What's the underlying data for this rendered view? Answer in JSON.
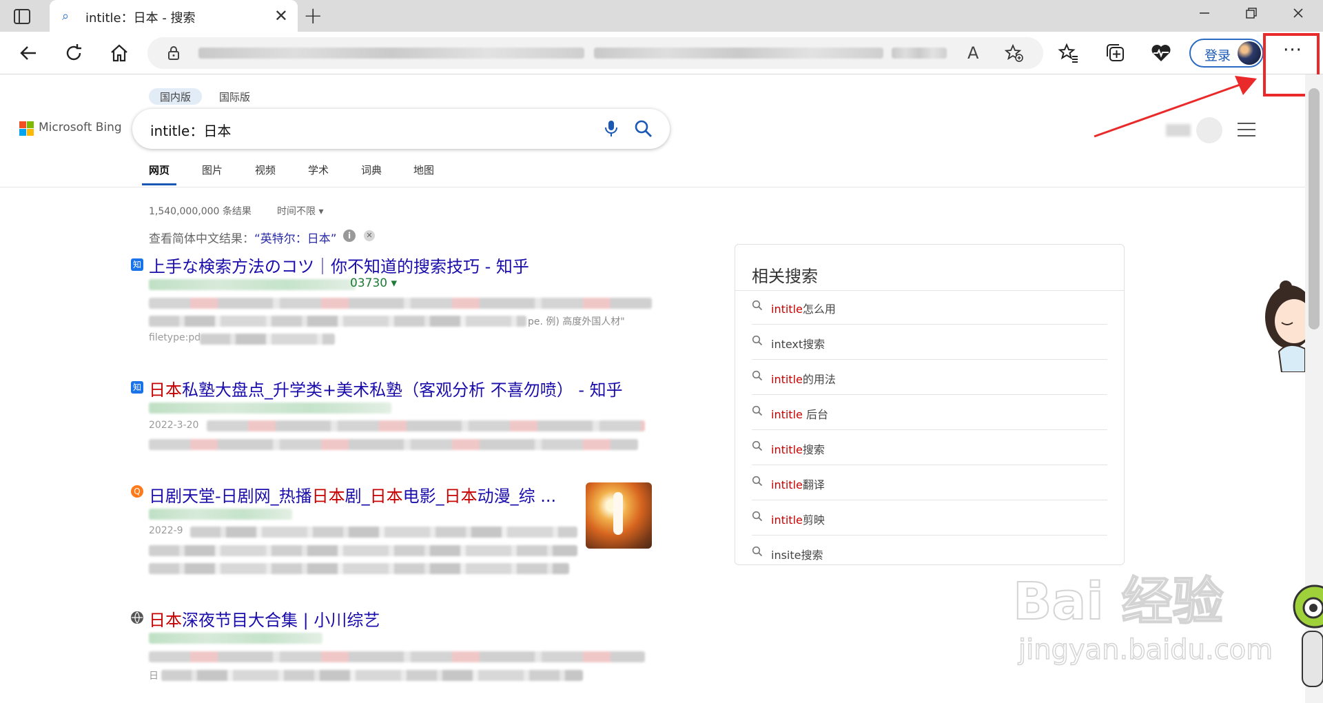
{
  "browser": {
    "tab_title": "intitle：日本 - 搜索",
    "new_tab": "+",
    "tab_close": "✕",
    "read_aloud": "A",
    "login_label": "登录",
    "more_label": "···"
  },
  "page": {
    "regions": [
      "国内版",
      "国际版"
    ],
    "logo_text": "Microsoft Bing",
    "query": "intitle：日本",
    "verticals": [
      "网页",
      "图片",
      "视频",
      "学术",
      "词典",
      "地图"
    ],
    "result_count": "1,540,000,000 条结果",
    "time_filter": "时间不限",
    "cn_prefix": "查看简体中文结果：",
    "cn_link": "“英特尔：日本”",
    "info_icon": "i",
    "dismiss_icon": "✕"
  },
  "results": [
    {
      "favicon": "知",
      "title_parts": [
        {
          "text": "上手な検索方法のコツ｜你不知道的搜索技巧 - 知乎",
          "hl": false
        }
      ],
      "url_tail": "03730 ▾",
      "snippet_fragment": "pe. 例) 高度外国人材\"",
      "snippet_fragment2": "filetype:pd"
    },
    {
      "favicon": "知",
      "title_parts": [
        {
          "text": "日本",
          "hl": true
        },
        {
          "text": "私塾大盘点_升学类+美术私塾（客观分析 不喜勿喷） - 知乎",
          "hl": false
        }
      ],
      "snippet_fragment": "2022-3-20"
    },
    {
      "favicon": "Q",
      "title_parts": [
        {
          "text": "日剧天堂-日剧网_热播",
          "hl": false
        },
        {
          "text": "日本",
          "hl": true
        },
        {
          "text": "剧_",
          "hl": false
        },
        {
          "text": "日本",
          "hl": true
        },
        {
          "text": "电影_",
          "hl": false
        },
        {
          "text": "日本",
          "hl": true
        },
        {
          "text": "动漫_综 ...",
          "hl": false
        }
      ],
      "snippet_fragment": "2022-9"
    },
    {
      "favicon": "🌐",
      "title_parts": [
        {
          "text": "日本",
          "hl": true
        },
        {
          "text": "深夜节目大合集 | 小川综艺",
          "hl": false
        }
      ],
      "snippet_fragment": "日"
    }
  ],
  "related": {
    "heading": "相关搜索",
    "items": [
      {
        "hl": "intitle",
        "rest": "怎么用"
      },
      {
        "hl": "",
        "rest": "intext搜索"
      },
      {
        "hl": "intitle",
        "rest": "的用法"
      },
      {
        "hl": "intitle",
        "rest": " 后台"
      },
      {
        "hl": "intitle",
        "rest": "搜索"
      },
      {
        "hl": "intitle",
        "rest": "翻译"
      },
      {
        "hl": "intitle",
        "rest": "剪映"
      },
      {
        "hl": "",
        "rest": "insite搜索"
      }
    ]
  },
  "watermark": {
    "main": "Bai 经验",
    "sub": "jingyan.baidu.com"
  },
  "colors": {
    "accent": "#1a58b5",
    "link": "#1a0dab",
    "highlight": "#c80000",
    "annotation": "#ea2a2a"
  }
}
